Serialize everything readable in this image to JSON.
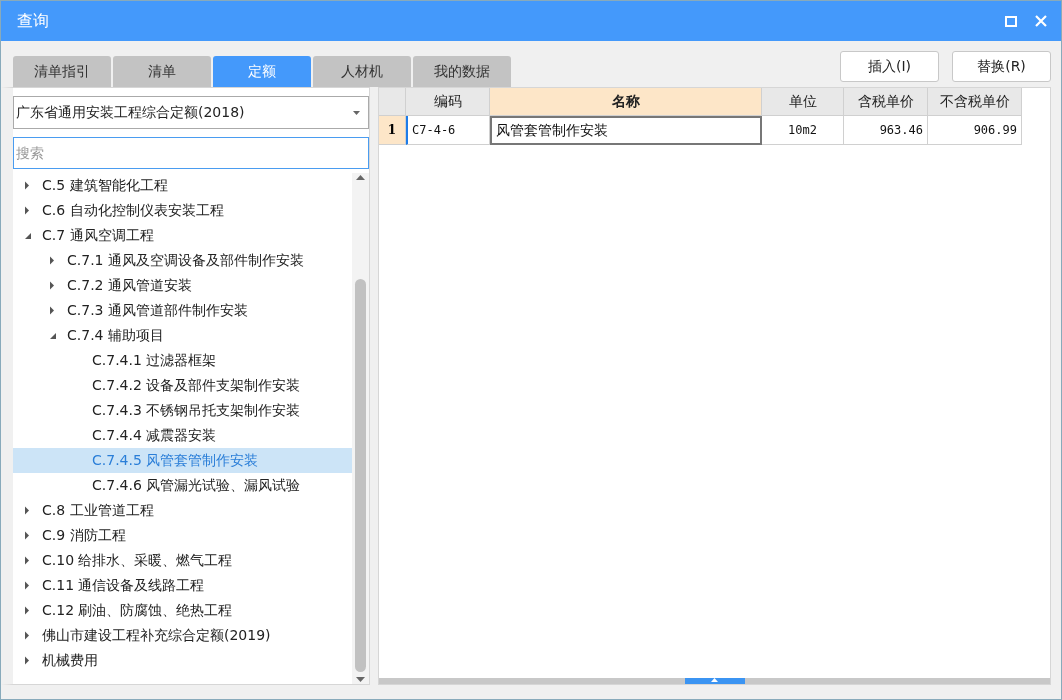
{
  "window": {
    "title": "查询"
  },
  "tabs": [
    {
      "label": "清单指引",
      "selected": false
    },
    {
      "label": "清单",
      "selected": false
    },
    {
      "label": "定额",
      "selected": true
    },
    {
      "label": "人材机",
      "selected": false
    },
    {
      "label": "我的数据",
      "selected": false
    }
  ],
  "buttons": [
    "插入(I)",
    "替换(R)"
  ],
  "library_select": {
    "value": "广东省通用安装工程综合定额(2018)"
  },
  "search": {
    "placeholder": "搜索"
  },
  "tree": {
    "items": [
      {
        "label": "C.5 建筑智能化工程",
        "expanded": false,
        "selected": false
      },
      {
        "label": "C.6 自动化控制仪表安装工程",
        "expanded": false,
        "selected": false
      },
      {
        "label": "C.7 通风空调工程",
        "expanded": true,
        "selected": false,
        "children": [
          {
            "label": "C.7.1 通风及空调设备及部件制作安装",
            "expanded": false,
            "selected": false
          },
          {
            "label": "C.7.2 通风管道安装",
            "expanded": false,
            "selected": false
          },
          {
            "label": "C.7.3 通风管道部件制作安装",
            "expanded": false,
            "selected": false
          },
          {
            "label": "C.7.4 辅助项目",
            "expanded": true,
            "selected": false,
            "children": [
              {
                "label": "C.7.4.1 过滤器框架",
                "selected": false
              },
              {
                "label": "C.7.4.2 设备及部件支架制作安装",
                "selected": false
              },
              {
                "label": "C.7.4.3 不锈钢吊托支架制作安装",
                "selected": false
              },
              {
                "label": "C.7.4.4 减震器安装",
                "selected": false
              },
              {
                "label": "C.7.4.5 风管套管制作安装",
                "selected": true
              },
              {
                "label": "C.7.4.6 风管漏光试验、漏风试验",
                "selected": false
              }
            ]
          }
        ]
      },
      {
        "label": "C.8 工业管道工程",
        "expanded": false,
        "selected": false
      },
      {
        "label": "C.9 消防工程",
        "expanded": false,
        "selected": false
      },
      {
        "label": "C.10 给排水、采暖、燃气工程",
        "expanded": false,
        "selected": false
      },
      {
        "label": "C.11 通信设备及线路工程",
        "expanded": false,
        "selected": false
      },
      {
        "label": "C.12 刷油、防腐蚀、绝热工程",
        "expanded": false,
        "selected": false
      },
      {
        "label": "佛山市建设工程补充综合定额(2019)",
        "expanded": false,
        "selected": false
      },
      {
        "label": "机械费用",
        "expanded": false,
        "selected": false
      }
    ]
  },
  "table": {
    "columns": [
      {
        "label": "编码",
        "selected": false
      },
      {
        "label": "名称",
        "selected": true
      },
      {
        "label": "单位",
        "selected": false
      },
      {
        "label": "含税单价",
        "selected": false
      },
      {
        "label": "不含税单价",
        "selected": false
      }
    ],
    "rows": [
      {
        "number": "1",
        "selected": true,
        "cells": [
          "C7-4-6",
          "风管套管制作安装",
          "10m2",
          "963.46",
          "906.99"
        ]
      }
    ]
  }
}
